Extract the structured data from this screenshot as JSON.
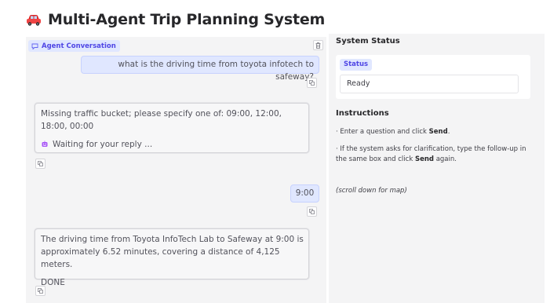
{
  "app": {
    "title": "Multi-Agent Trip Planning System",
    "icon": "car-icon"
  },
  "chat": {
    "tab_label": "Agent Conversation",
    "messages": [
      {
        "role": "user",
        "text": "what is the driving time from toyota infotech to safeway?"
      },
      {
        "role": "assistant",
        "lines": [
          "Missing traffic bucket; please specify one of: 09:00, 12:00, 18:00, 00:00",
          "Waiting for your reply ..."
        ],
        "emoji": "robot-icon"
      },
      {
        "role": "user",
        "text": "9:00"
      },
      {
        "role": "assistant",
        "lines": [
          "The driving time from Toyota InfoTech Lab to Safeway at 9:00 is approximately 6.52 minutes, covering a distance of 4,125 meters.",
          "DONE"
        ]
      }
    ]
  },
  "status_panel": {
    "heading": "System Status",
    "label": "Status",
    "value": "Ready"
  },
  "instructions": {
    "heading": "Instructions",
    "line1_pre": "· Enter a question and click ",
    "line1_bold": "Send",
    "line1_post": ".",
    "line2_pre": "· If the system asks for clarification, type the follow-up in the same box and click ",
    "line2_bold": "Send",
    "line2_post": " again.",
    "note": "(scroll down for map)"
  },
  "colors": {
    "accent": "#4f46e5",
    "user_bubble": "#e0e7ff",
    "panel_bg": "#f4f4f5"
  }
}
